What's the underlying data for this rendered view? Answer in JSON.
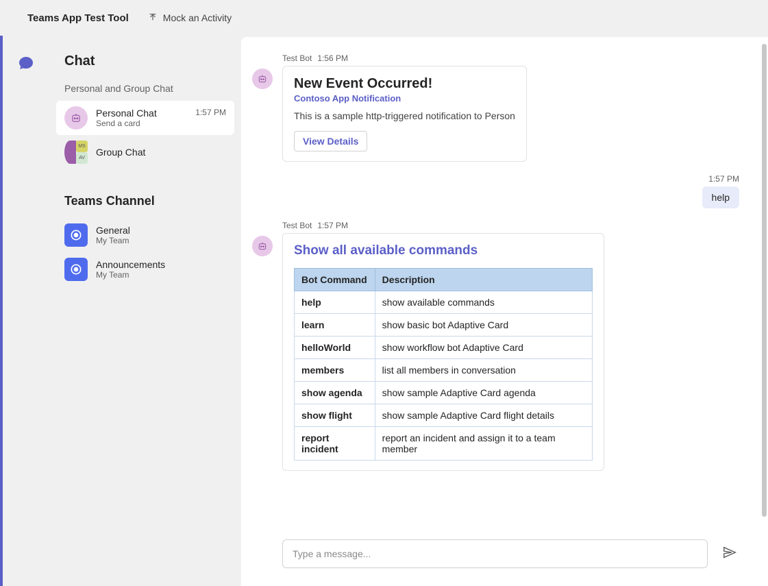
{
  "topbar": {
    "title": "Teams App Test Tool",
    "mock_label": "Mock an Activity"
  },
  "sidebar": {
    "chat_heading": "Chat",
    "chat_subhead": "Personal and Group Chat",
    "items": [
      {
        "title": "Personal Chat",
        "sub": "Send a card",
        "time": "1:57 PM"
      },
      {
        "title": "Group Chat",
        "sub": "",
        "time": ""
      }
    ],
    "channel_heading": "Teams Channel",
    "channels": [
      {
        "title": "General",
        "sub": "My Team"
      },
      {
        "title": "Announcements",
        "sub": "My Team"
      }
    ]
  },
  "messages": {
    "m1": {
      "author": "Test Bot",
      "time": "1:56 PM",
      "title": "New Event Occurred!",
      "subtitle": "Contoso App Notification",
      "body": "This is a sample http-triggered notification to Person",
      "button": "View Details"
    },
    "m2": {
      "time": "1:57 PM",
      "text": "help"
    },
    "m3": {
      "author": "Test Bot",
      "time": "1:57 PM",
      "heading": "Show all available commands",
      "table": {
        "headers": [
          "Bot Command",
          "Description"
        ],
        "rows": [
          [
            "help",
            "show available commands"
          ],
          [
            "learn",
            "show basic bot Adaptive Card"
          ],
          [
            "helloWorld",
            "show workflow bot Adaptive Card"
          ],
          [
            "members",
            "list all members in conversation"
          ],
          [
            "show agenda",
            "show sample Adaptive Card agenda"
          ],
          [
            "show flight",
            "show sample Adaptive Card flight details"
          ],
          [
            "report incident",
            "report an incident and assign it to a team member"
          ]
        ]
      }
    }
  },
  "compose": {
    "placeholder": "Type a message..."
  }
}
